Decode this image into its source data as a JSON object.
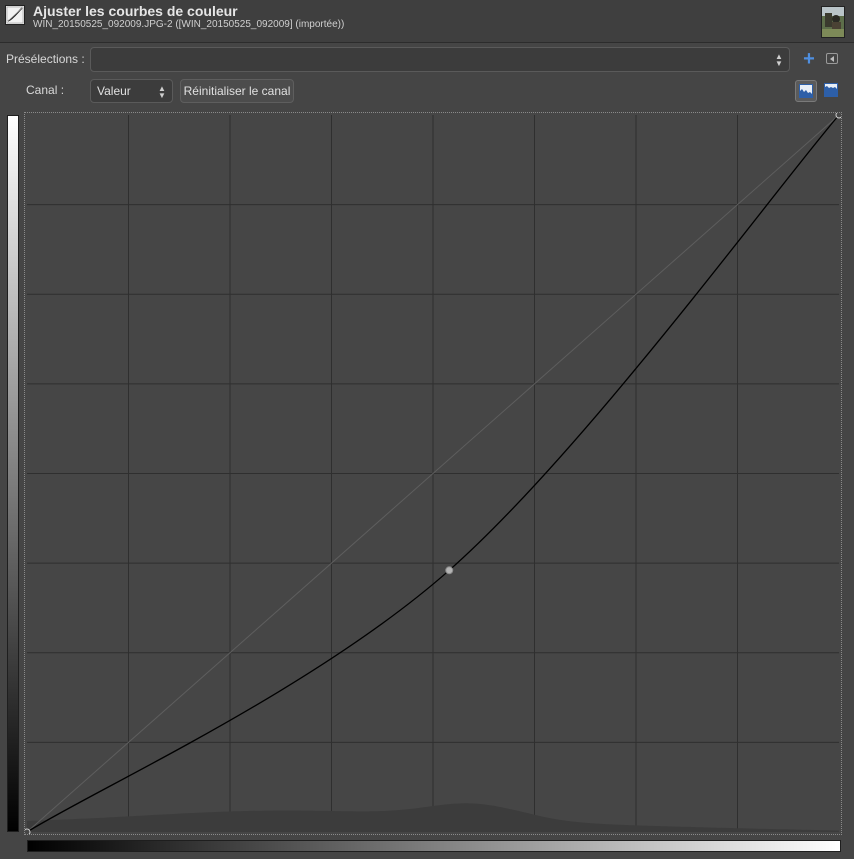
{
  "header": {
    "title": "Ajuster les courbes de couleur",
    "subtitle": "WIN_20150525_092009.JPG-2 ([WIN_20150525_092009] (importée))",
    "icon": "curves-tool-icon",
    "thumbnail_icon": "image-thumbnail"
  },
  "presets": {
    "label": "Présélections :",
    "value": "",
    "add_icon": "plus-icon",
    "menu_icon": "menu-arrow-icon"
  },
  "channel": {
    "label": "Canal :",
    "value": "Valeur",
    "reset_label": "Réinitialiser le canal",
    "histogram_linear_icon": "histogram-linear-icon",
    "histogram_log_icon": "histogram-log-icon"
  },
  "curve": {
    "control_points": [
      {
        "in": 0,
        "out": 0
      },
      {
        "in": 0.52,
        "out": 0.365
      },
      {
        "in": 1,
        "out": 1
      }
    ],
    "grid_divisions": 8,
    "colors": {
      "curve": "#000000",
      "identity": "#5e5e5e",
      "grid": "#2f2f2f",
      "histogram": "#3c3c3c",
      "point": "#b4b4b4"
    }
  }
}
